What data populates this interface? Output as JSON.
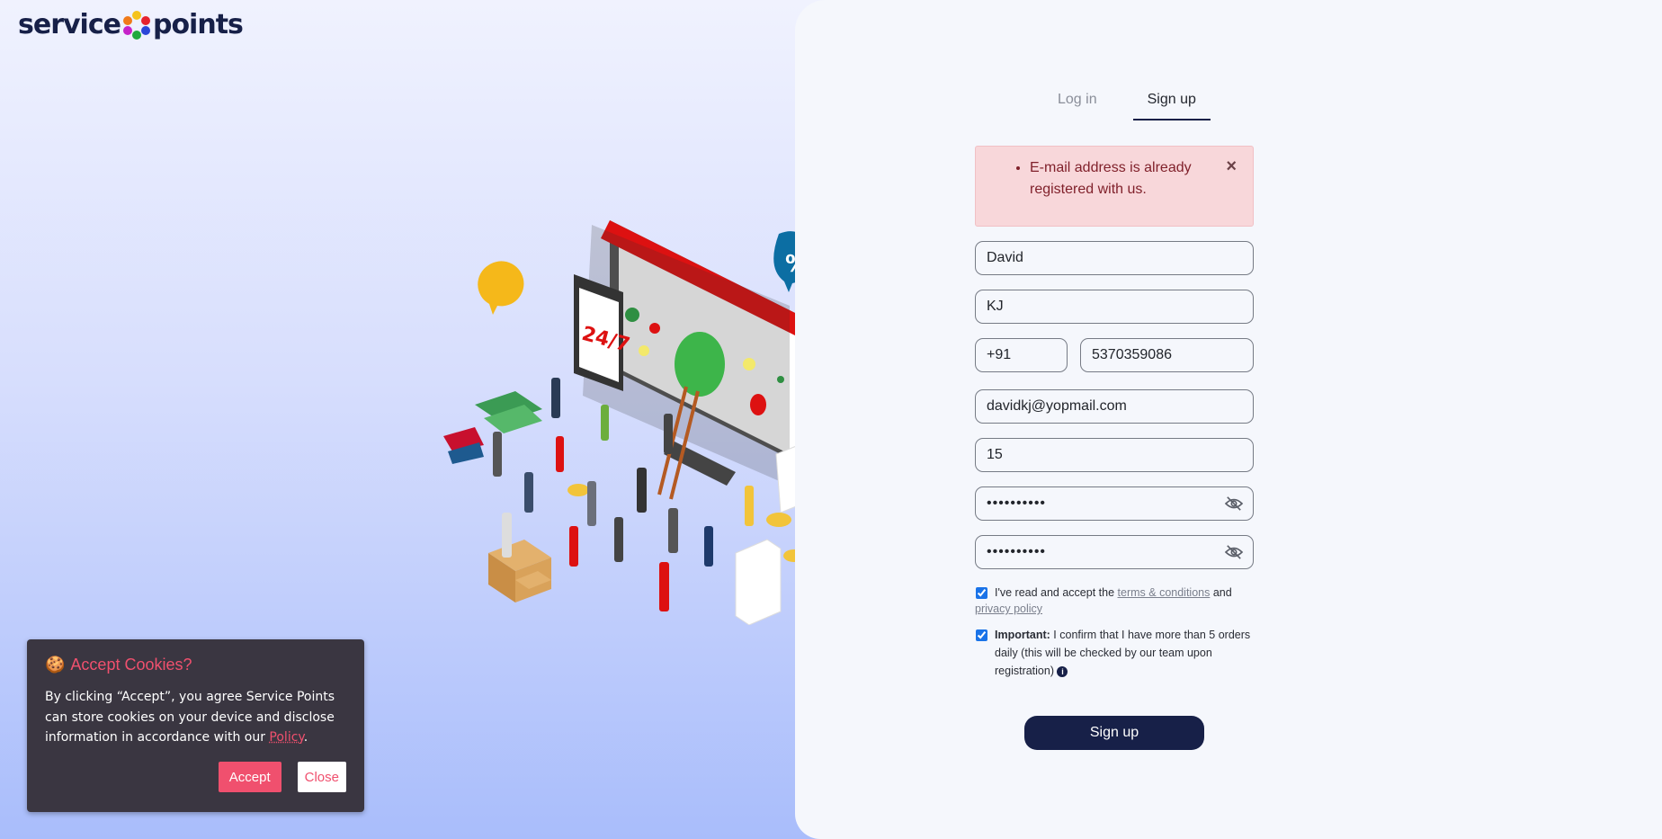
{
  "brand": {
    "logo_text_left": "service",
    "logo_text_right": "points"
  },
  "tabs": [
    {
      "label": "Log in",
      "active": false
    },
    {
      "label": "Sign up",
      "active": true
    }
  ],
  "alert": {
    "message": "E-mail address is already registered with us.",
    "close_symbol": "×"
  },
  "form": {
    "first_name": "David",
    "last_name": "KJ",
    "country_code": "+91",
    "phone": "5370359086",
    "email": "davidkj@yopmail.com",
    "orders": "15",
    "password": "••••••••••",
    "confirm_password": "••••••••••",
    "terms_prefix": "I've read and accept the",
    "terms_link": "terms & conditions",
    "terms_and": "and",
    "privacy_link": "privacy policy",
    "important_label": "Important:",
    "important_text": "I confirm that I have more than 5 orders daily (this will be checked by our team upon registration)",
    "info_symbol": "i",
    "submit_label": "Sign up"
  },
  "cookie": {
    "icon": "🍪",
    "title": "Accept Cookies?",
    "text": "By clicking “Accept”, you agree Service Points can store cookies on your device and disclose information in accordance with our",
    "policy_link": "Policy",
    "period": ".",
    "accept_label": "Accept",
    "close_label": "Close"
  },
  "illustration": {
    "badge_247": "24/7",
    "percent": "%"
  },
  "colors": {
    "navy": "#172048",
    "alert_bg": "#f8d7da",
    "cookie_bg": "#3a3641",
    "cookie_accent": "#f0506e"
  }
}
